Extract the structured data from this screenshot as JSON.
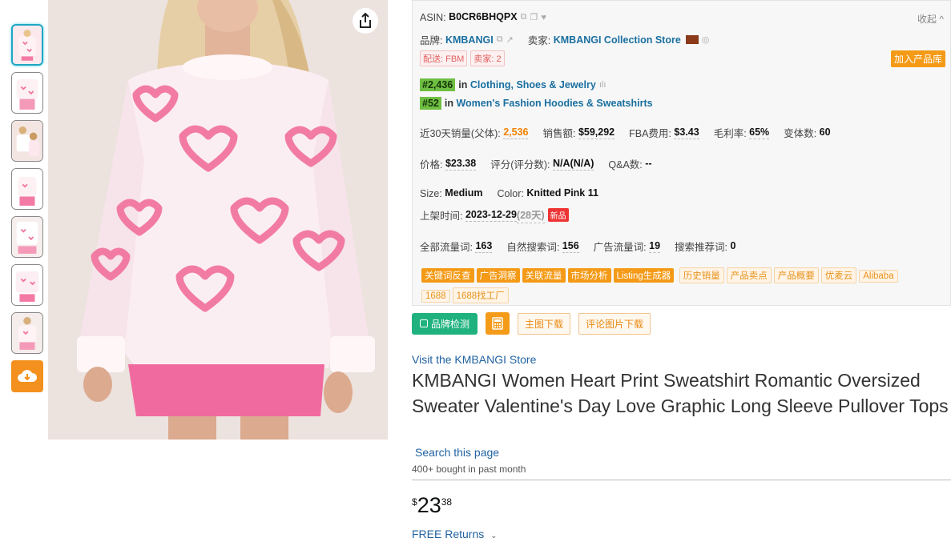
{
  "colors": {
    "accent_orange": "#f49a16",
    "badge_green": "#6fbf42",
    "link_blue": "#2162a1",
    "brand_green": "#1fb27f"
  },
  "thumbnails": {
    "count": 7,
    "active_index": 0
  },
  "panel": {
    "asin_label": "ASIN:",
    "asin": "B0CR6BHQPX",
    "collapse": "收起 ^",
    "brand_label": "品牌:",
    "brand": "KMBANGI",
    "seller_label": "卖家:",
    "seller": "KMBANGI Collection Store",
    "ship_tag": "配送: FBM",
    "sellers_tag": "卖家: 2",
    "add_button": "加入产品库",
    "rank1": "#2,436",
    "rank1_in": "in",
    "rank1_cat": "Clothing, Shoes & Jewelry",
    "rank2": "#52",
    "rank2_in": "in",
    "rank2_cat": "Women's Fashion Hoodies & Sweatshirts",
    "sales_label": "近30天销量(父体):",
    "sales": "2,536",
    "revenue_label": "销售额:",
    "revenue": "$59,292",
    "fba_label": "FBA费用:",
    "fba": "$3.43",
    "margin_label": "毛利率:",
    "margin": "65%",
    "variants_label": "变体数:",
    "variants": "60",
    "price_label": "价格:",
    "price": "$23.38",
    "rating_label": "评分(评分数):",
    "rating": "N/A(N/A)",
    "qa_label": "Q&A数:",
    "qa": "--",
    "size_label": "Size:",
    "size": "Medium",
    "color_label": "Color:",
    "color": "Knitted Pink 11",
    "listed_label": "上架时间:",
    "listed": "2023-12-29",
    "listed_days": "(28天)",
    "new_badge": "新品",
    "traffic_all_label": "全部流量词:",
    "traffic_all": "163",
    "organic_label": "自然搜索词:",
    "organic": "156",
    "ad_label": "广告流量词:",
    "ad": "19",
    "recommend_label": "搜索推荐词:",
    "recommend": "0",
    "tools_solid": [
      "关键词反查",
      "广告洞察",
      "关联流量",
      "市场分析",
      "Listing生成器"
    ],
    "tools_outline": [
      "历史销量",
      "产品卖点",
      "产品概要",
      "优麦云",
      "Alibaba",
      "1688",
      "1688找工厂"
    ]
  },
  "actions": {
    "brand_check": "品牌检测",
    "main_img_download": "主图下载",
    "review_img_download": "评论图片下载"
  },
  "product": {
    "store_link": "Visit the KMBANGI Store",
    "title": "KMBANGI Women Heart Print Sweatshirt Romantic Oversized Sweater Valentine's Day Love Graphic Long Sleeve Pullover Tops",
    "search_page": "Search this page",
    "bought": "400+ bought in past month",
    "price_symbol": "$",
    "price_whole": "23",
    "price_fraction": "38",
    "returns": "FREE Returns"
  }
}
